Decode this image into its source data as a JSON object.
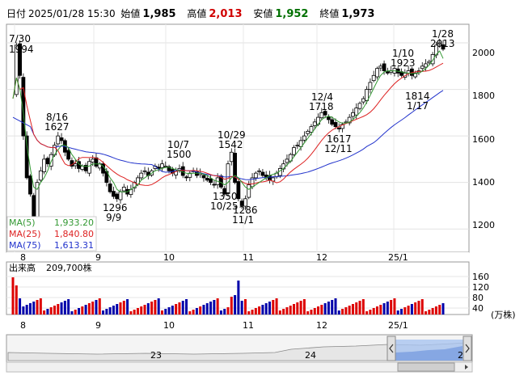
{
  "header": {
    "date_label": "日付",
    "datetime": "2025/01/28 15:30",
    "open_label": "始値",
    "open": "1,985",
    "high_label": "高値",
    "high": "2,013",
    "low_label": "安値",
    "low": "1,952",
    "close_label": "終値",
    "close": "1,973"
  },
  "colors": {
    "up": "#d00000",
    "down": "#0000cc",
    "ma5": "#339933",
    "ma25": "#dd2222",
    "ma75": "#2233cc",
    "volume_up": "#dd0000",
    "volume_down": "#0000aa"
  },
  "price_axis": {
    "ticks": [
      "2000",
      "1800",
      "1600",
      "1400",
      "1200"
    ]
  },
  "month_labels": [
    "8",
    "9",
    "10",
    "11",
    "12",
    "25/1"
  ],
  "legend": {
    "ma5_label": "MA(5)",
    "ma5_value": "1,933.20",
    "ma25_label": "MA(25)",
    "ma25_value": "1,840.80",
    "ma75_label": "MA(75)",
    "ma75_value": "1,613.31"
  },
  "annotations": {
    "a1_date": "7/30",
    "a1_price": "1994",
    "a2_date": "8/16",
    "a2_price": "1627",
    "a3_price": "1296",
    "a3_date": "9/9",
    "a4_date": "10/7",
    "a4_price": "1500",
    "a5_date": "10/29",
    "a5_price": "1542",
    "a6_price": "1350",
    "a6_date": "10/25",
    "a7_price": "1286",
    "a7_date": "11/1",
    "a8_date": "12/4",
    "a8_price": "1718",
    "a9_price": "1617",
    "a9_date": "12/11",
    "a10_date": "1/10",
    "a10_price": "1923",
    "a11_price": "1814",
    "a11_date": "1/17",
    "a12_date": "1/28",
    "a12_price": "2013"
  },
  "volume": {
    "label": "出来高",
    "value": "209,700株",
    "ticks": [
      "160",
      "120",
      "80",
      "40"
    ],
    "unit": "(万株)"
  },
  "navigator": {
    "labels": [
      "23",
      "24",
      "2"
    ]
  },
  "chart_data": {
    "type": "candlestick",
    "title": "",
    "period": "2024/07 – 2025/01 daily",
    "ylim": [
      1100,
      2080
    ],
    "annotated_points": [
      {
        "date": "7/30",
        "value": 1994
      },
      {
        "date": "8/16",
        "value": 1627
      },
      {
        "date": "9/9",
        "value": 1296
      },
      {
        "date": "10/7",
        "value": 1500
      },
      {
        "date": "10/25",
        "value": 1350
      },
      {
        "date": "10/29",
        "value": 1542
      },
      {
        "date": "11/1",
        "value": 1286
      },
      {
        "date": "12/4",
        "value": 1718
      },
      {
        "date": "12/11",
        "value": 1617
      },
      {
        "date": "1/10",
        "value": 1923
      },
      {
        "date": "1/17",
        "value": 1814
      },
      {
        "date": "1/28",
        "value": 2013
      }
    ],
    "close_path": [
      1780,
      1990,
      1860,
      1600,
      1420,
      1350,
      1250,
      1400,
      1450,
      1500,
      1480,
      1520,
      1560,
      1600,
      1580,
      1530,
      1500,
      1470,
      1480,
      1460,
      1470,
      1450,
      1490,
      1500,
      1470,
      1480,
      1440,
      1400,
      1360,
      1340,
      1330,
      1360,
      1380,
      1350,
      1370,
      1400,
      1420,
      1440,
      1450,
      1430,
      1450,
      1470,
      1460,
      1480,
      1470,
      1450,
      1440,
      1450,
      1460,
      1430,
      1420,
      1440,
      1450,
      1430,
      1440,
      1420,
      1410,
      1400,
      1390,
      1420,
      1380,
      1350,
      1480,
      1530,
      1400,
      1330,
      1300,
      1330,
      1390,
      1420,
      1440,
      1450,
      1430,
      1420,
      1410,
      1420,
      1440,
      1460,
      1480,
      1500,
      1520,
      1550,
      1560,
      1580,
      1600,
      1620,
      1640,
      1660,
      1680,
      1700,
      1690,
      1670,
      1650,
      1640,
      1630,
      1650,
      1660,
      1680,
      1700,
      1720,
      1740,
      1760,
      1800,
      1830,
      1860,
      1890,
      1900,
      1880,
      1870,
      1880,
      1890,
      1870,
      1860,
      1870,
      1880,
      1860,
      1870,
      1880,
      1900,
      1910,
      1920,
      1950,
      1990,
      2000,
      1973
    ],
    "ma5": [
      1760,
      1850,
      1800,
      1700,
      1560,
      1460,
      1380,
      1370,
      1400,
      1420,
      1450,
      1490,
      1520,
      1540,
      1560,
      1560,
      1550,
      1520,
      1500,
      1480,
      1470,
      1470,
      1470,
      1480,
      1480,
      1480,
      1470,
      1450,
      1420,
      1400,
      1370,
      1360,
      1360,
      1360,
      1370,
      1380,
      1390,
      1410,
      1420,
      1430,
      1440,
      1450,
      1455,
      1460,
      1465,
      1465,
      1460,
      1455,
      1450,
      1445,
      1440,
      1438,
      1440,
      1440,
      1440,
      1435,
      1430,
      1420,
      1410,
      1405,
      1400,
      1390,
      1400,
      1420,
      1430,
      1420,
      1400,
      1380,
      1370,
      1380,
      1390,
      1400,
      1410,
      1420,
      1430,
      1435,
      1440,
      1450,
      1460,
      1475,
      1490,
      1510,
      1530,
      1550,
      1570,
      1590,
      1610,
      1630,
      1650,
      1670,
      1680,
      1685,
      1680,
      1670,
      1660,
      1655,
      1655,
      1660,
      1670,
      1685,
      1700,
      1720,
      1745,
      1775,
      1805,
      1835,
      1860,
      1875,
      1880,
      1880,
      1880,
      1878,
      1875,
      1872,
      1870,
      1868,
      1868,
      1870,
      1878,
      1890,
      1905,
      1925,
      1950,
      1965,
      1933
    ]
  }
}
